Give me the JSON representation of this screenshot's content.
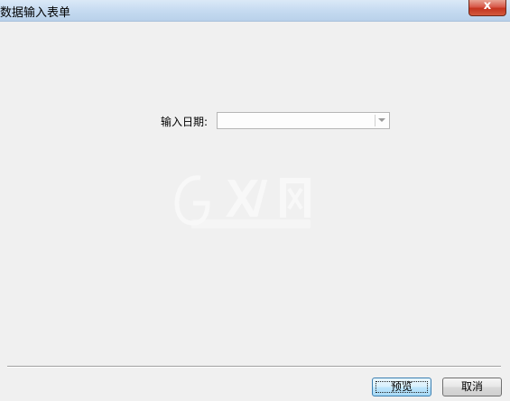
{
  "window": {
    "title": "数据输入表单",
    "close_symbol": "x"
  },
  "form": {
    "date_label": "输入日期:",
    "date_value": ""
  },
  "buttons": {
    "preview_label": "预览",
    "cancel_label": "取消"
  },
  "icons": {
    "close": "close-icon",
    "dropdown": "chevron-down-icon"
  }
}
